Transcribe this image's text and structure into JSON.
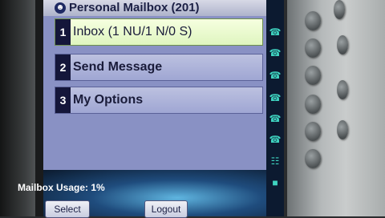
{
  "window": {
    "title": "Personal Mailbox (201)",
    "title_icon": "speech-bubble-icon"
  },
  "menu": {
    "items": [
      {
        "number": "1",
        "label": "Inbox (1 NU/1 N/0 S)",
        "selected": true
      },
      {
        "number": "2",
        "label": "Send Message",
        "selected": false
      },
      {
        "number": "3",
        "label": "My Options",
        "selected": false
      }
    ]
  },
  "status": {
    "usage": "Mailbox Usage: 1%"
  },
  "softkeys": {
    "select": "Select",
    "logout": "Logout"
  },
  "line_keys": {
    "icons": [
      "phone-icon",
      "phone-icon",
      "phone-icon",
      "phone-icon",
      "phone-icon",
      "phone-icon",
      "directory-icon",
      "video-icon"
    ]
  },
  "colors": {
    "screen_bg": "#2d4d92",
    "list_bg": "#8991c4",
    "selected_item": "#dff5bf",
    "line_icon": "#3fd3c0"
  }
}
